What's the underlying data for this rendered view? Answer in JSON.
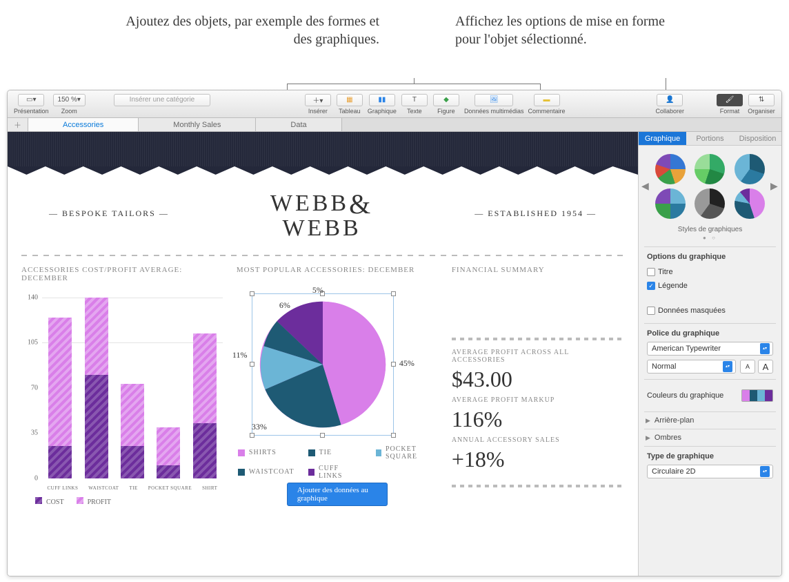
{
  "callouts": {
    "left": "Ajoutez des objets, par exemple des formes et des graphiques.",
    "right": "Affichez les options de mise en forme pour l'objet sélectionné."
  },
  "toolbar": {
    "presentation": "Présentation",
    "zoom_value": "150 %",
    "zoom_label": "Zoom",
    "category_placeholder": "Insérer une catégorie",
    "insert": "Insérer",
    "table": "Tableau",
    "chart": "Graphique",
    "text": "Texte",
    "shape": "Figure",
    "media": "Données multimédias",
    "comment": "Commentaire",
    "collaborate": "Collaborer",
    "format": "Format",
    "organize": "Organiser"
  },
  "sheets": [
    "Accessories",
    "Monthly Sales",
    "Data"
  ],
  "brand": {
    "left": "— BESPOKE TAILORS —",
    "logo_top": "WEBB",
    "logo_bottom": "WEBB",
    "right": "— ESTABLISHED 1954 —"
  },
  "bar": {
    "title": "ACCESSORIES COST/PROFIT AVERAGE: DECEMBER",
    "yticks": [
      "140",
      "105",
      "70",
      "35",
      "0"
    ],
    "categories": [
      "CUFF LINKS",
      "WAISTCOAT",
      "TIE",
      "POCKET SQUARE",
      "SHIRT"
    ],
    "legend": {
      "cost": "COST",
      "profit": "PROFIT"
    }
  },
  "pie": {
    "title": "MOST POPULAR ACCESSORIES: DECEMBER",
    "labels": {
      "p45": "45%",
      "p33": "33%",
      "p11": "11%",
      "p6": "6%",
      "p5": "5%"
    },
    "legend": [
      "SHIRTS",
      "TIE",
      "POCKET SQUARE",
      "WAISTCOAT",
      "CUFF LINKS"
    ],
    "button": "Ajouter des données au graphique"
  },
  "summary": {
    "title": "FINANCIAL SUMMARY",
    "l1": "AVERAGE PROFIT ACROSS ALL ACCESSORIES",
    "v1": "$43.00",
    "l2": "AVERAGE PROFIT MARKUP",
    "v2": "116%",
    "l3": "ANNUAL ACCESSORY SALES",
    "v3": "+18%"
  },
  "inspector": {
    "tabs": [
      "Graphique",
      "Portions",
      "Disposition"
    ],
    "styles_label": "Styles de graphiques",
    "options_h": "Options du graphique",
    "title_chk": "Titre",
    "legend_chk": "Légende",
    "hidden_chk": "Données masquées",
    "font_h": "Police du graphique",
    "font_name": "American Typewriter",
    "font_style": "Normal",
    "colors_label": "Couleurs du graphique",
    "bg": "Arrière-plan",
    "shadow": "Ombres",
    "type_h": "Type de graphique",
    "type_val": "Circulaire 2D"
  },
  "chart_data": [
    {
      "type": "bar",
      "stacked": true,
      "title": "ACCESSORIES COST/PROFIT AVERAGE: DECEMBER",
      "categories": [
        "CUFF LINKS",
        "WAISTCOAT",
        "TIE",
        "POCKET SQUARE",
        "SHIRT"
      ],
      "series": [
        {
          "name": "COST",
          "values": [
            25,
            80,
            25,
            10,
            42
          ]
        },
        {
          "name": "PROFIT",
          "values": [
            100,
            60,
            48,
            29,
            70
          ]
        }
      ],
      "ylim": [
        0,
        140
      ]
    },
    {
      "type": "pie",
      "title": "MOST POPULAR ACCESSORIES: DECEMBER",
      "categories": [
        "SHIRTS",
        "WAISTCOAT",
        "TIE",
        "POCKET SQUARE",
        "CUFF LINKS"
      ],
      "values": [
        45,
        33,
        11,
        6,
        5
      ]
    }
  ]
}
